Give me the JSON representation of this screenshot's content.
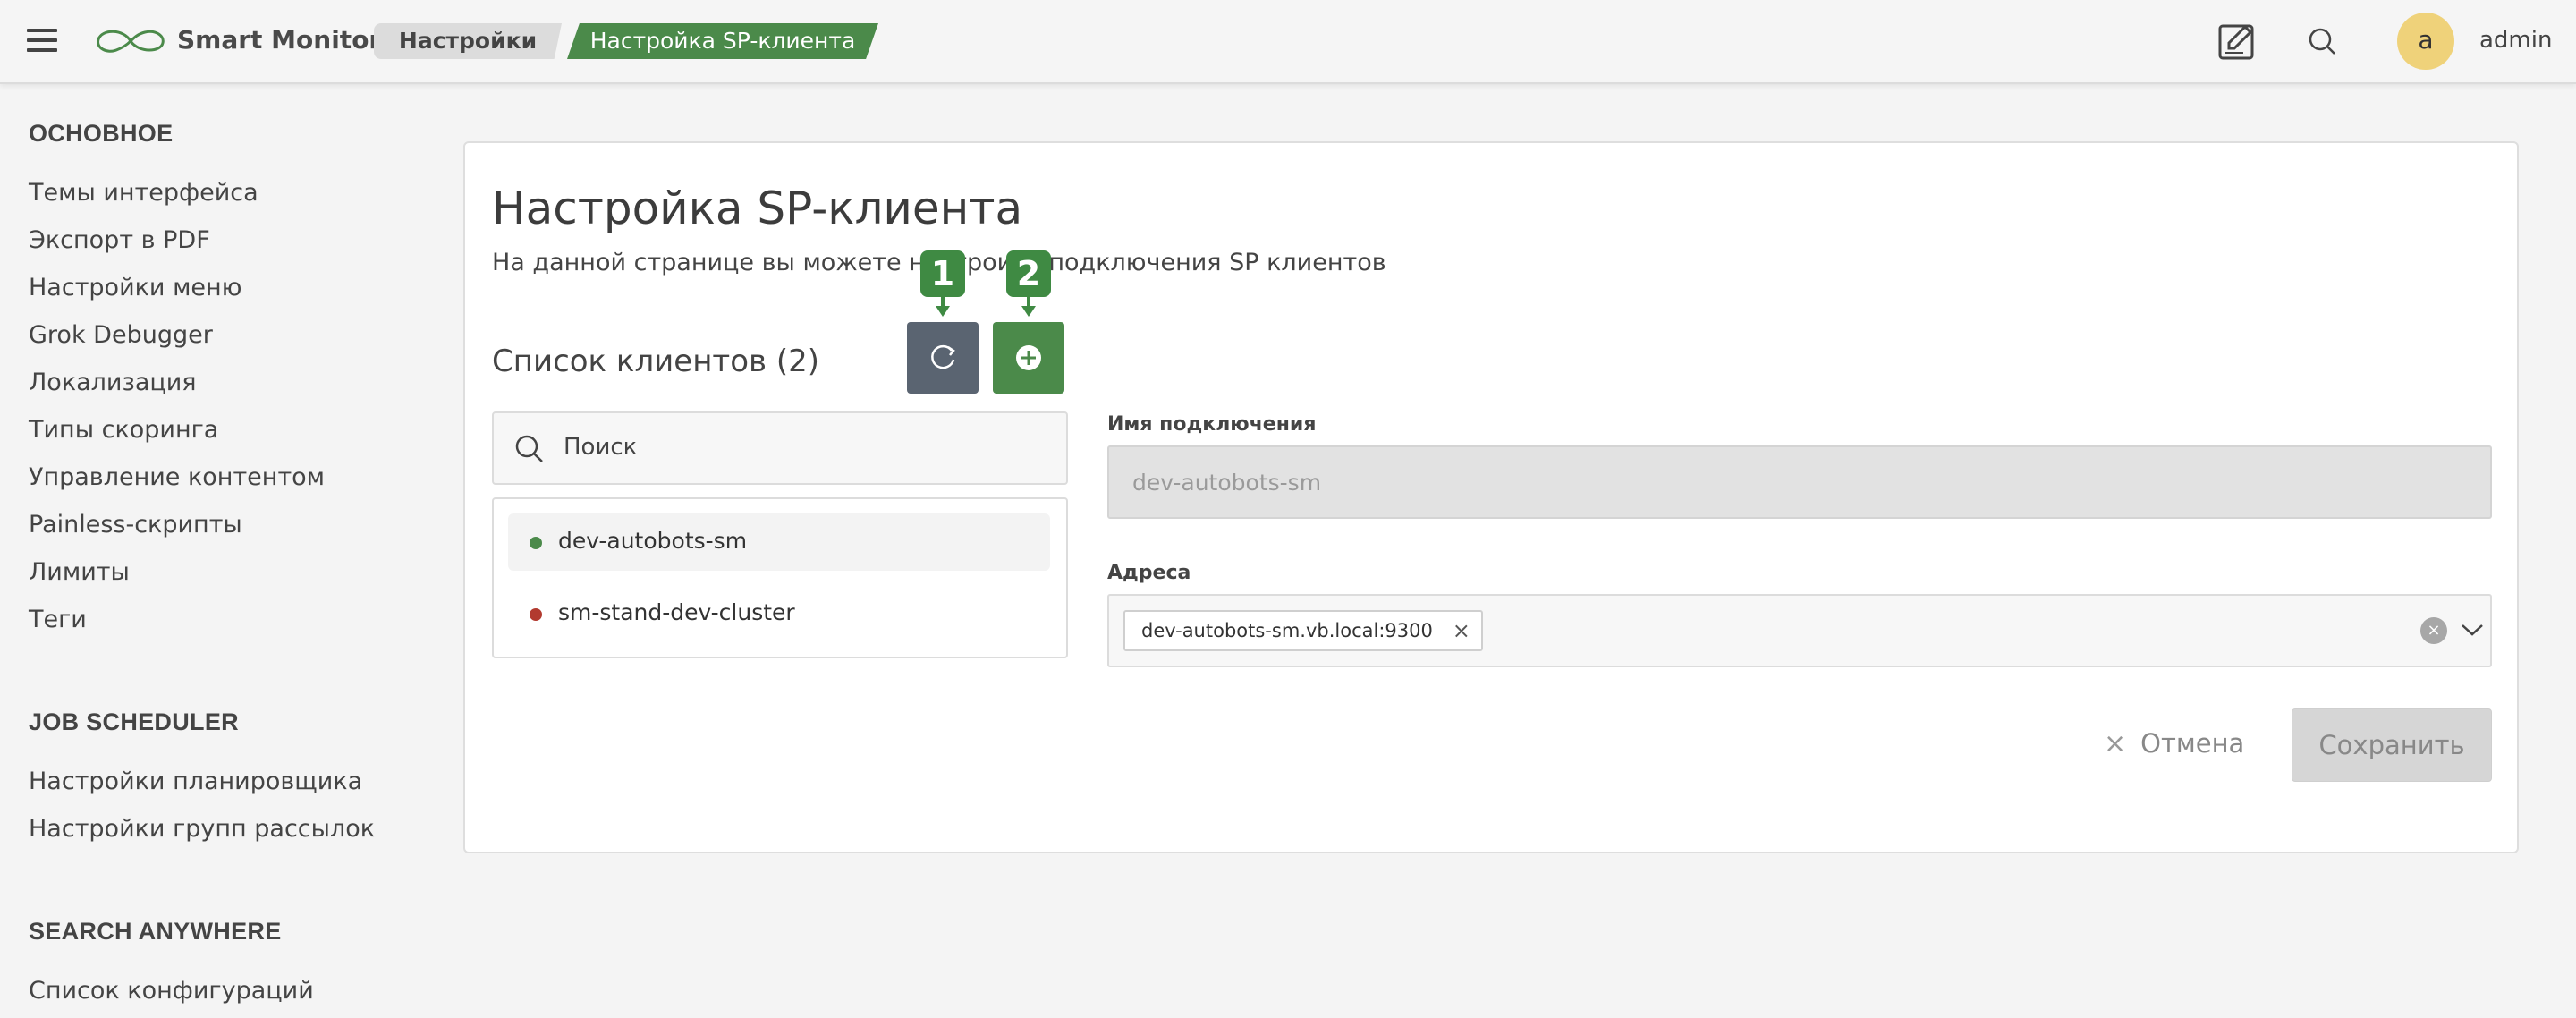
{
  "header": {
    "app_title": "Smart Monitor",
    "breadcrumbs": [
      "Настройки",
      "Настройка SP-клиента"
    ],
    "avatar_letter": "a",
    "username": "admin",
    "accent_color": "#4b8a4a"
  },
  "sidebar": {
    "sections": [
      {
        "title": "ОСНОВНОЕ",
        "items": [
          "Темы интерфейса",
          "Экспорт в PDF",
          "Настройки меню",
          "Grok Debugger",
          "Локализация",
          "Типы скоринга",
          "Управление контентом",
          "Painless-скрипты",
          "Лимиты",
          "Теги"
        ]
      },
      {
        "title": "JOB SCHEDULER",
        "items": [
          "Настройки планировщика",
          "Настройки групп рассылок"
        ]
      },
      {
        "title": "SEARCH ANYWHERE",
        "items": [
          "Список конфигураций"
        ]
      }
    ]
  },
  "main": {
    "title": "Настройка SP-клиента",
    "description": "На данной странице вы можете настроить подключения SP клиентов",
    "list_title": "Список клиентов (2)",
    "markers": [
      "1",
      "2"
    ],
    "search_placeholder": "Поиск",
    "clients": [
      {
        "name": "dev-autobots-sm",
        "status_color": "#4b8a4a",
        "active": true
      },
      {
        "name": "sm-stand-dev-cluster",
        "status_color": "#b23a2f",
        "active": false
      }
    ],
    "form": {
      "connection_name_label": "Имя подключения",
      "connection_name_value": "dev-autobots-sm",
      "addresses_label": "Адреса",
      "addresses": [
        "dev-autobots-sm.vb.local:9300"
      ],
      "cancel_label": "Отмена",
      "save_label": "Сохранить"
    }
  }
}
